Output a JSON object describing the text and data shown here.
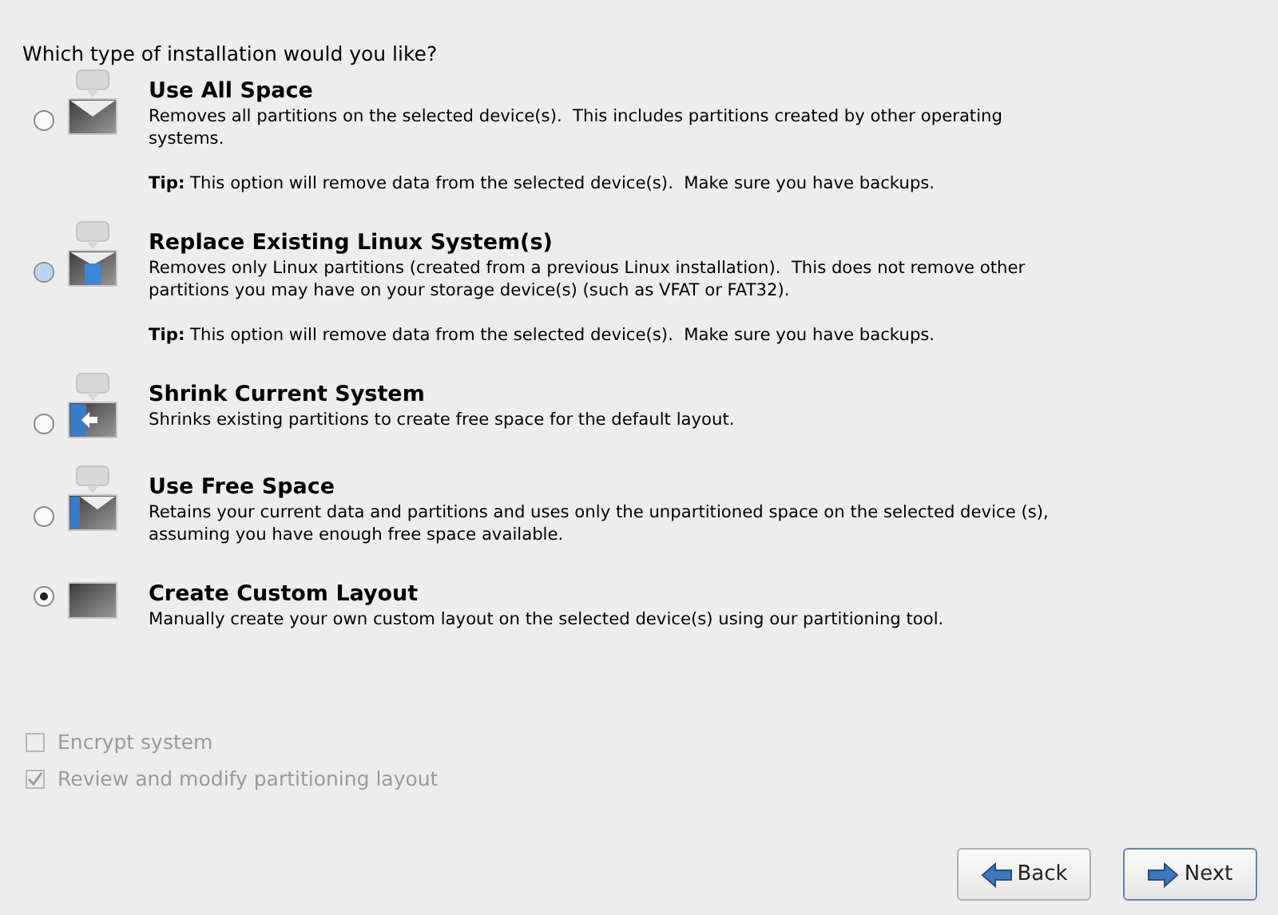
{
  "heading": "Which type of installation would you like?",
  "options": [
    {
      "kind": "all",
      "title": "Use All Space",
      "description": "Removes all partitions on the selected device(s).  This includes partitions created by other operating systems.",
      "tip": "**Tip:** This option will remove data from the selected device(s).  Make sure you have backups.",
      "selected": false,
      "hovered": false
    },
    {
      "kind": "replace",
      "title": "Replace Existing Linux System(s)",
      "description": "Removes only Linux partitions (created from a previous Linux installation).  This does not remove other partitions you may have on your storage device(s) (such as VFAT or FAT32).",
      "tip": "**Tip:** This option will remove data from the selected device(s).  Make sure you have backups.",
      "selected": false,
      "hovered": true
    },
    {
      "kind": "shrink",
      "title": "Shrink Current System",
      "description": "Shrinks existing partitions to create free space for the default layout.",
      "selected": false,
      "hovered": false
    },
    {
      "kind": "free",
      "title": "Use Free Space",
      "description": "Retains your current data and partitions and uses only the unpartitioned space on the selected device (s), assuming you have enough free space available.",
      "selected": false,
      "hovered": false
    },
    {
      "kind": "custom",
      "title": "Create Custom Layout",
      "description": "Manually create your own custom layout on the selected device(s) using our partitioning tool.",
      "selected": true,
      "hovered": false
    }
  ],
  "checkboxes": [
    {
      "label": "Encrypt system",
      "checked": false,
      "disabled": true
    },
    {
      "label": "Review and modify partitioning layout",
      "checked": true,
      "disabled": true
    }
  ],
  "buttons": [
    {
      "kind": "back",
      "label": "Back"
    },
    {
      "kind": "next",
      "label": "Next"
    }
  ]
}
